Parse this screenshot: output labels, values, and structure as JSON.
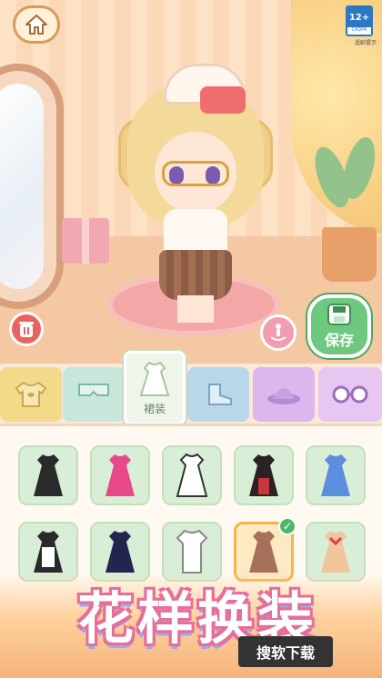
{
  "header": {
    "age_rating": "12+",
    "age_rating_mark": "CADPA",
    "age_notice": "适龄提示"
  },
  "actions": {
    "save_label": "保存"
  },
  "categories": [
    {
      "id": "tops",
      "icon": "shirt-icon",
      "color": "#f3d98a"
    },
    {
      "id": "pants",
      "icon": "pants-icon",
      "color": "#c7e7dd"
    },
    {
      "id": "dresses",
      "icon": "dress-icon",
      "color": "#eef6ec",
      "label": "裙装",
      "active": true
    },
    {
      "id": "shoes",
      "icon": "boot-icon",
      "color": "#b9d7e9"
    },
    {
      "id": "hats",
      "icon": "hat-icon",
      "color": "#dbb7ee"
    },
    {
      "id": "glasses",
      "icon": "glasses-icon",
      "color": "#e7c7f1"
    }
  ],
  "items": [
    {
      "name": "black-gothic-dress",
      "color": "#2a2a2a"
    },
    {
      "name": "pink-black-dress",
      "color": "#e8488a"
    },
    {
      "name": "white-star-dress",
      "color": "#ffffff"
    },
    {
      "name": "black-red-coat-dress",
      "color": "#2d2223"
    },
    {
      "name": "blue-sailor-dress",
      "color": "#5d8ddd"
    },
    {
      "name": "maid-dress",
      "color": "#2a2a2a"
    },
    {
      "name": "navy-lolita-dress",
      "color": "#23254f"
    },
    {
      "name": "white-shirt-outfit",
      "color": "#ffffff"
    },
    {
      "name": "brown-plaid-dress",
      "color": "#a5715a",
      "selected": true
    },
    {
      "name": "cream-red-bow-dress",
      "color": "#f1c59c"
    }
  ],
  "banner": {
    "title": "花样换装",
    "download_label": "搜软下载"
  }
}
